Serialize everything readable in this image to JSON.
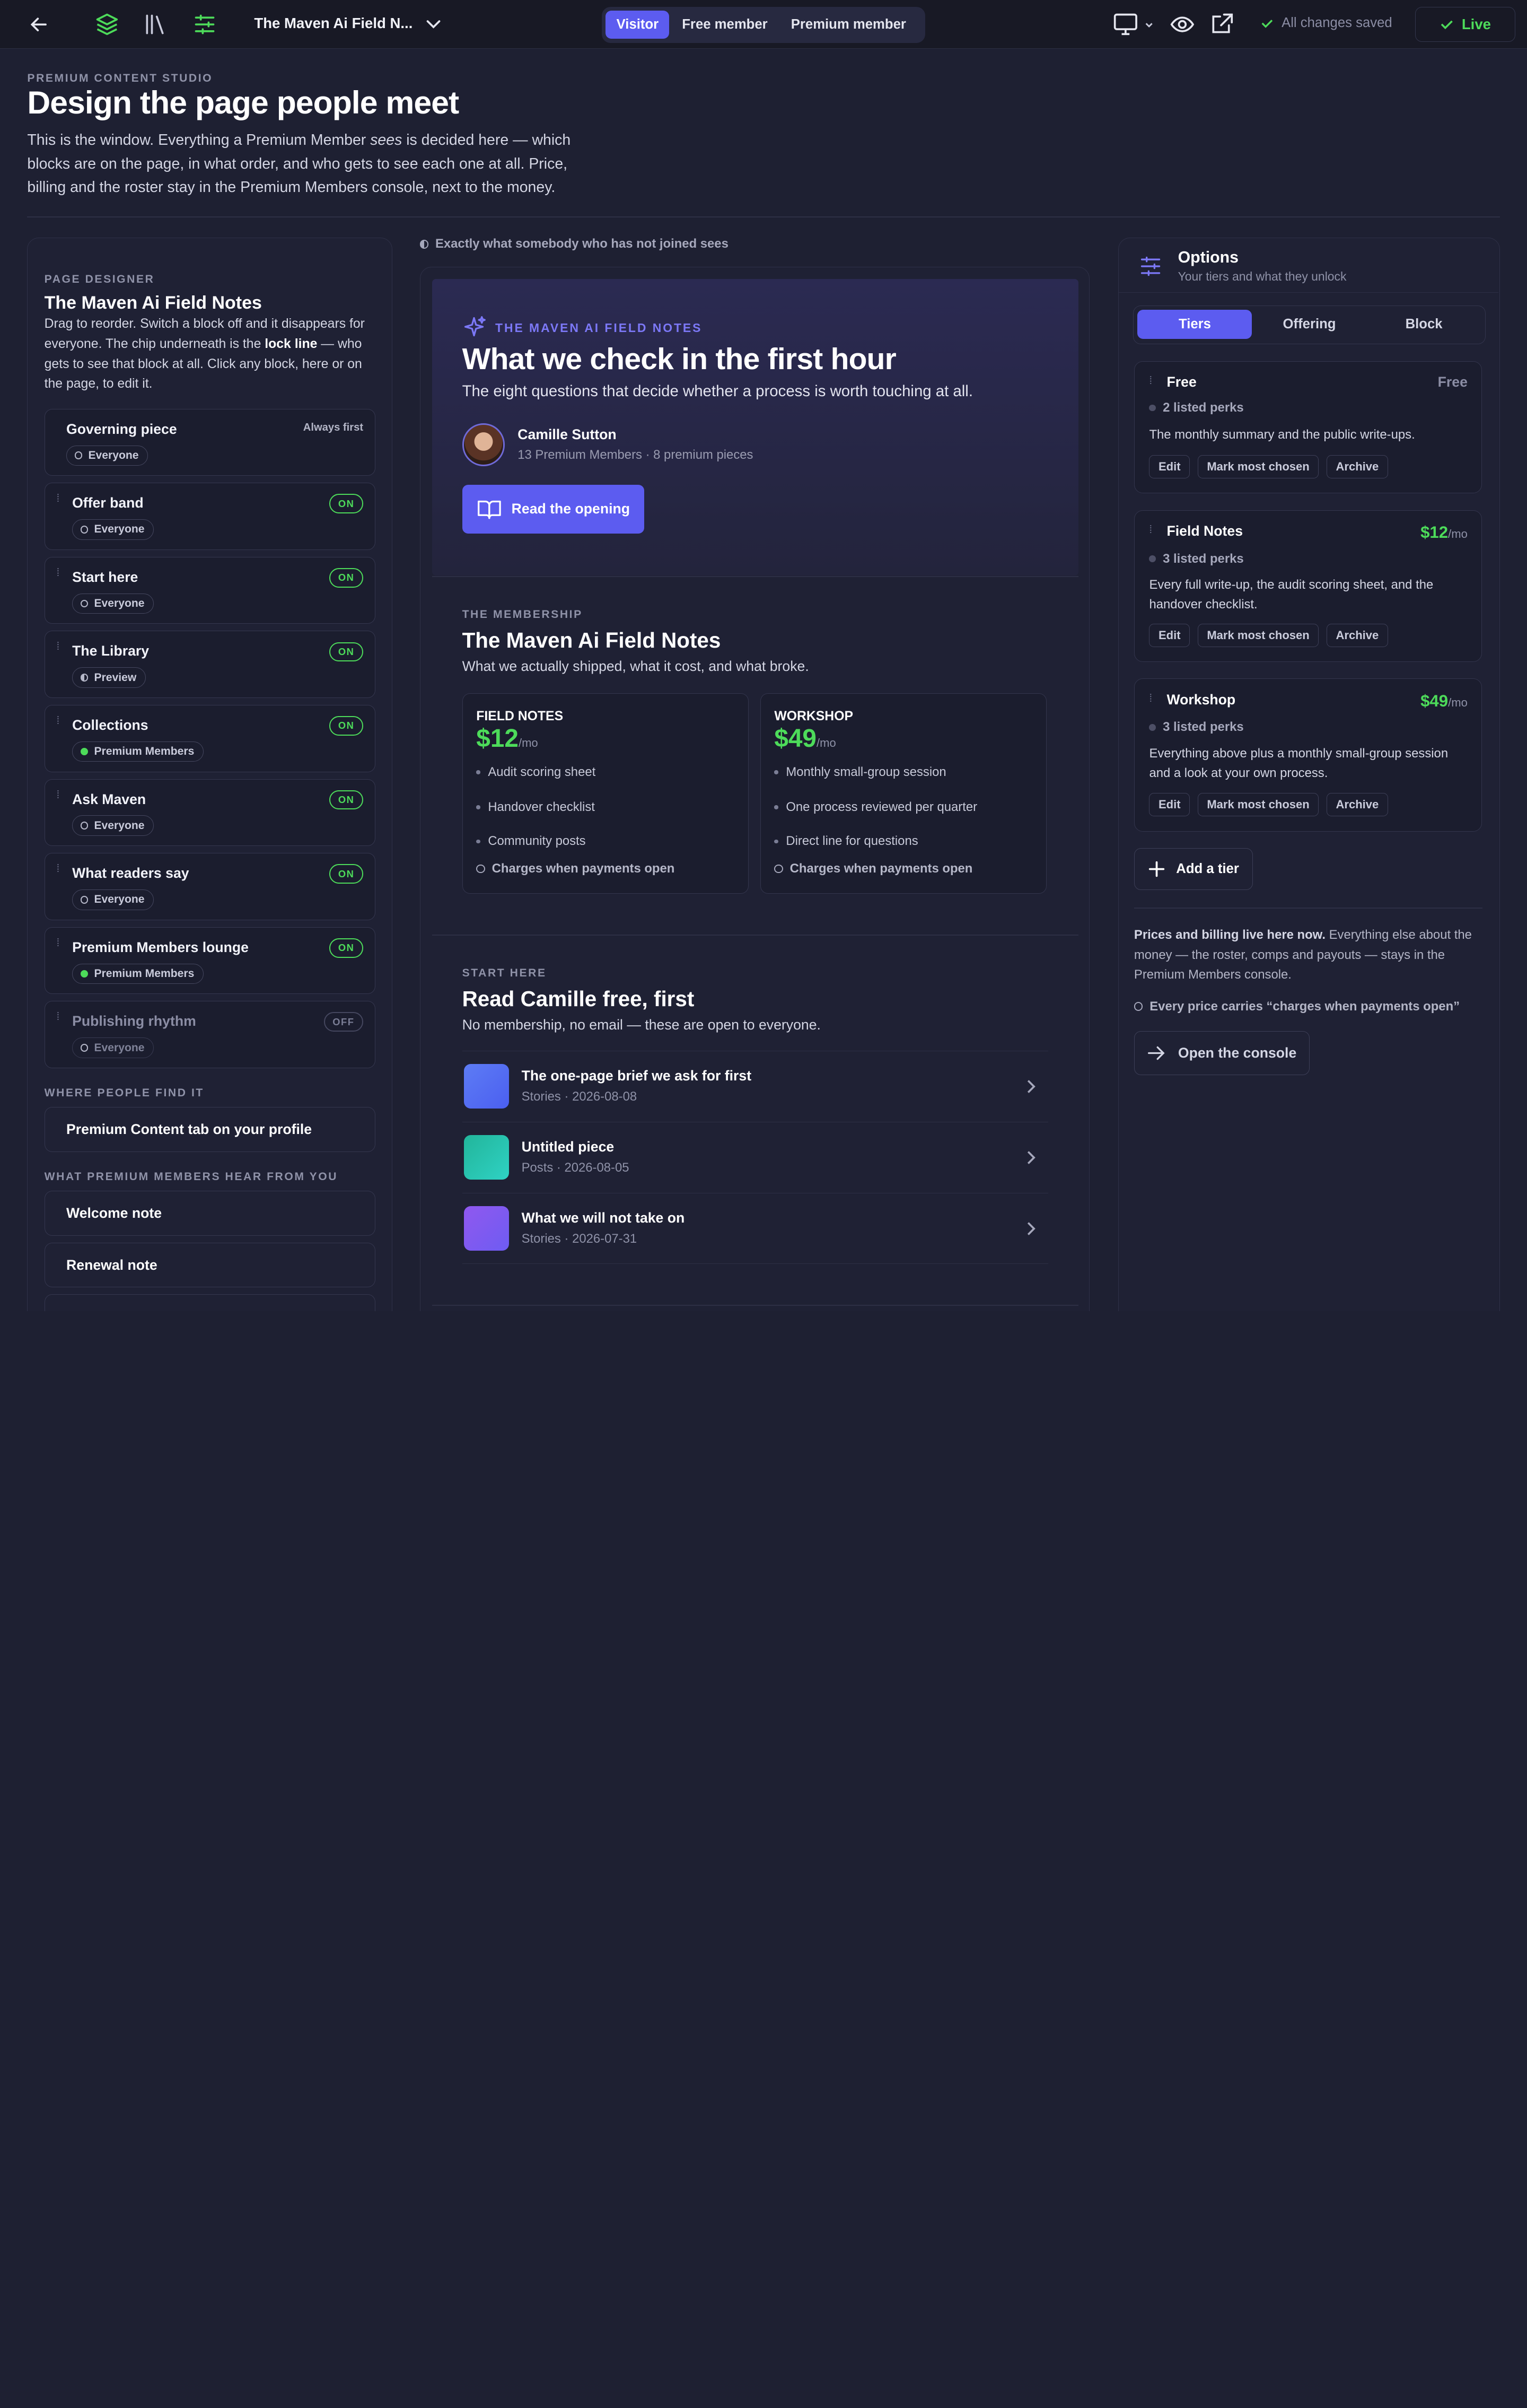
{
  "topbar": {
    "title": "The Maven Ai Field N...",
    "view_as": [
      "Visitor",
      "Free member",
      "Premium member"
    ],
    "saved": "All changes saved",
    "live": "Live"
  },
  "header": {
    "eyebrow": "PREMIUM CONTENT STUDIO",
    "title": "Design the page people meet",
    "desc_a": "This is the window. Everything a Premium Member ",
    "desc_em": "sees",
    "desc_b": " is decided here — which blocks are on the page, in what order, and who gets to see each one at all. Price, billing and the roster stay in the Premium Members console, next to the money."
  },
  "designer": {
    "eyebrow": "PAGE DESIGNER",
    "title": "The Maven Ai Field Notes",
    "desc_a": "Drag to reorder. Switch a block off and it disappears for everyone. The chip underneath is the ",
    "desc_b": "lock line",
    "desc_c": " — who gets to see that block at all. Click any block, here or on the page, to edit it.",
    "blocks": [
      {
        "name": "Governing piece",
        "chip": "Everyone",
        "state": "Always first"
      },
      {
        "name": "Offer band",
        "chip": "Everyone",
        "state": "ON"
      },
      {
        "name": "Start here",
        "chip": "Everyone",
        "state": "ON"
      },
      {
        "name": "The Library",
        "chip": "Preview",
        "state": "ON"
      },
      {
        "name": "Collections",
        "chip": "Premium Members",
        "state": "ON"
      },
      {
        "name": "Ask Maven",
        "chip": "Everyone",
        "state": "ON"
      },
      {
        "name": "What readers say",
        "chip": "Everyone",
        "state": "ON"
      },
      {
        "name": "Premium Members lounge",
        "chip": "Premium Members",
        "state": "ON"
      },
      {
        "name": "Publishing rhythm",
        "chip": "Everyone",
        "state": "OFF"
      }
    ],
    "find_label": "WHERE PEOPLE FIND IT",
    "find_value": "Premium Content tab on your profile",
    "hear_label": "WHAT PREMIUM MEMBERS HEAR FROM YOU",
    "hear_items": [
      "Welcome note",
      "Renewal note"
    ]
  },
  "preview": {
    "note": "Exactly what somebody who has not joined sees",
    "hero": {
      "eyebrow": "THE MAVEN AI FIELD NOTES",
      "title": "What we check in the first hour",
      "subtitle": "The eight questions that decide whether a process is worth touching at all.",
      "author": "Camille Sutton",
      "author_meta": "13 Premium Members · 8 premium pieces",
      "cta": "Read the opening"
    },
    "membership": {
      "eyebrow": "THE MEMBERSHIP",
      "title": "The Maven Ai Field Notes",
      "subtitle": "What we actually shipped, what it cost, and what broke.",
      "tiers": [
        {
          "name": "FIELD NOTES",
          "price": "$12",
          "per": "/mo",
          "perks": [
            "Audit scoring sheet",
            "Handover checklist",
            "Community posts"
          ],
          "charge": "Charges when payments open"
        },
        {
          "name": "WORKSHOP",
          "price": "$49",
          "per": "/mo",
          "perks": [
            "Monthly small-group session",
            "One process reviewed per quarter",
            "Direct line for questions"
          ],
          "charge": "Charges when payments open"
        }
      ]
    },
    "start": {
      "eyebrow": "START HERE",
      "title": "Read Camille free, first",
      "subtitle": "No membership, no email — these are open to everyone.",
      "items": [
        {
          "title": "The one-page brief we ask for first",
          "meta": "Stories · 2026-08-08"
        },
        {
          "title": "Untitled piece",
          "meta": "Posts · 2026-08-05"
        },
        {
          "title": "What we will not take on",
          "meta": "Stories · 2026-07-31"
        }
      ]
    }
  },
  "options": {
    "title": "Options",
    "subtitle": "Your tiers and what they unlock",
    "tabs": [
      "Tiers",
      "Offering",
      "Block"
    ],
    "tiers": [
      {
        "name": "Free",
        "price": "Free",
        "per": "",
        "perks": "2 listed perks",
        "desc": "The monthly summary and the public write-ups."
      },
      {
        "name": "Field Notes",
        "price": "$12",
        "per": "/mo",
        "perks": "3 listed perks",
        "desc": "Every full write-up, the audit scoring sheet, and the handover checklist."
      },
      {
        "name": "Workshop",
        "price": "$49",
        "per": "/mo",
        "perks": "3 listed perks",
        "desc": "Everything above plus a monthly small-group session and a look at your own process."
      }
    ],
    "actions": [
      "Edit",
      "Mark most chosen",
      "Archive"
    ],
    "add_tier": "Add a tier",
    "note_b": "Prices and billing live here now.",
    "note_rest": " Everything else about the money — the roster, comps and payouts — stays in the Premium Members console.",
    "ring_note": "Every price carries “charges when payments open”",
    "console": "Open the console"
  },
  "colors": {
    "accent": "#5c5cf0",
    "green": "#4ddb5a",
    "bg": "#1e2032"
  }
}
